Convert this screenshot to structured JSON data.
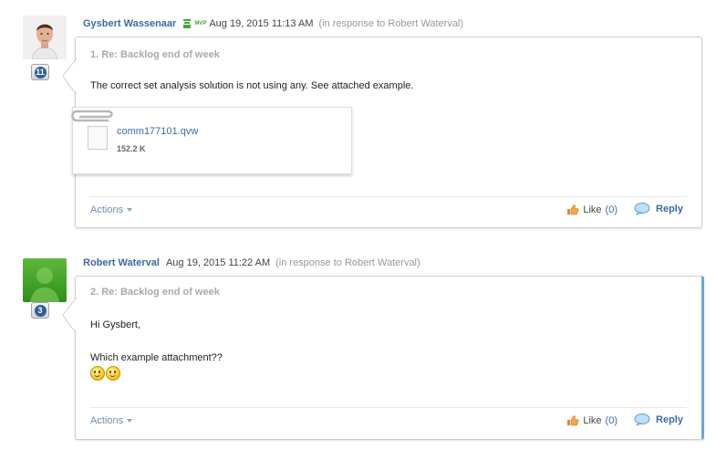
{
  "posts": [
    {
      "author": "Gysbert Wassenaar",
      "badge_level": "11",
      "mvp_label": "MVP",
      "date": "Aug 19, 2015 11:13 AM",
      "in_response": "(in response to Robert Waterval)",
      "subject": "1. Re: Backlog end of week",
      "body_lines": [
        "The correct set analysis solution is not using any. See attached example."
      ],
      "attachment": {
        "name": "comm177101.qvw",
        "size": "152.2 K"
      },
      "actions_label": "Actions",
      "like_label": "Like",
      "like_count": "(0)",
      "reply_label": "Reply"
    },
    {
      "author": "Robert Waterval",
      "badge_level": "3",
      "date": "Aug 19, 2015 11:22 AM",
      "in_response": "(in response to Robert Waterval)",
      "subject": "2. Re: Backlog end of week",
      "body_lines": [
        "Hi Gysbert,",
        "Which example attachment??"
      ],
      "emoticons": [
        "smile-icon",
        "smile-icon"
      ],
      "actions_label": "Actions",
      "like_label": "Like",
      "like_count": "(0)",
      "reply_label": "Reply"
    }
  ],
  "colors": {
    "link": "#3d6aa3",
    "highlight_border": "#6ea5db",
    "muted": "#999999"
  }
}
